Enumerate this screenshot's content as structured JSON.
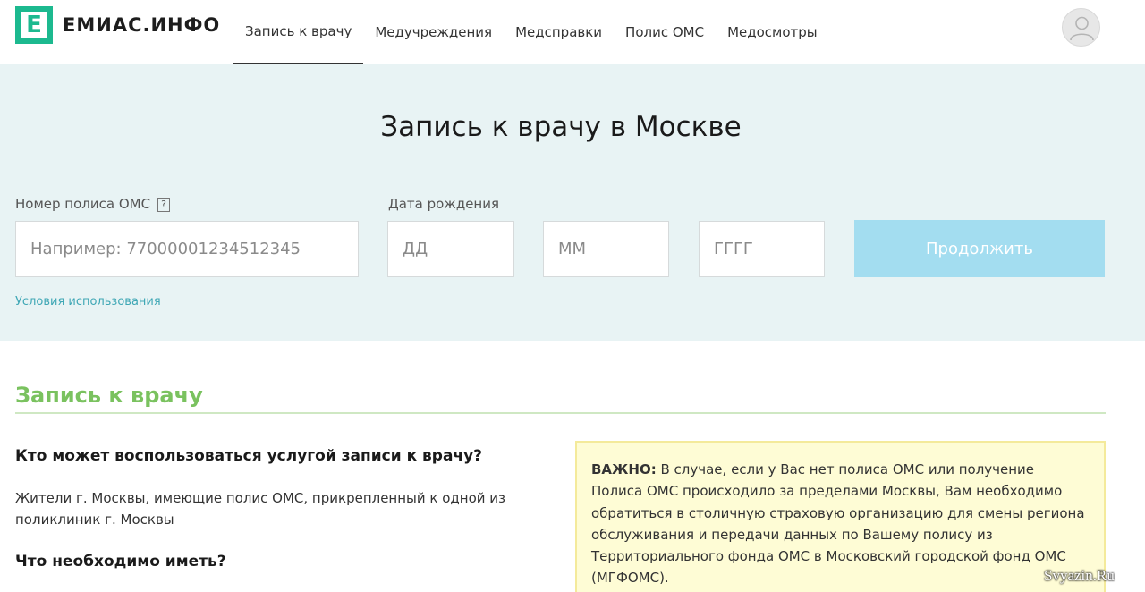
{
  "header": {
    "logo_letter": "E",
    "logo_text": "ЕМИАС.ИНФО",
    "nav": [
      {
        "label": "Запись к врачу",
        "active": true
      },
      {
        "label": "Медучреждения"
      },
      {
        "label": "Медсправки"
      },
      {
        "label": "Полис ОМС"
      },
      {
        "label": "Медосмотры"
      }
    ],
    "avatar_icon": "user-icon"
  },
  "form": {
    "title": "Запись к врачу в Москве",
    "policy_label": "Номер полиса ОМС",
    "help_glyph": "?",
    "policy_placeholder": "Например: 7700000123451234​5",
    "dob_label": "Дата рождения",
    "day_placeholder": "ДД",
    "month_placeholder": "ММ",
    "year_placeholder": "ГГГГ",
    "continue_label": "Продолжить",
    "terms_link": "Условия использования"
  },
  "content": {
    "section_title": "Запись к врачу",
    "q1": "Кто может воспользоваться услугой записи к врачу?",
    "a1": "Жители г. Москвы, имеющие полис ОМС, прикрепленный к одной из поликлиник г. Москвы",
    "q2": "Что необходимо иметь?",
    "notice_bold": "ВАЖНО:",
    "notice_text": " В случае, если у Вас нет полиса ОМС или получение Полиса ОМС происходило за пределами Москвы, Вам необходимо обратиться в столичную страховую организацию для смены региона обслуживания и передачи данных по Вашему полису из Территориального фонда ОМС в Московский городской фонд ОМС (МГФОМС)."
  },
  "watermark": "Svyazin.Ru",
  "colors": {
    "brand": "#1cb98f",
    "hero_bg": "#e8f3f4",
    "button": "#a3ddf0",
    "section_title": "#7ac25f",
    "link": "#3fa7b5",
    "notice_bg": "#fefcd5"
  }
}
